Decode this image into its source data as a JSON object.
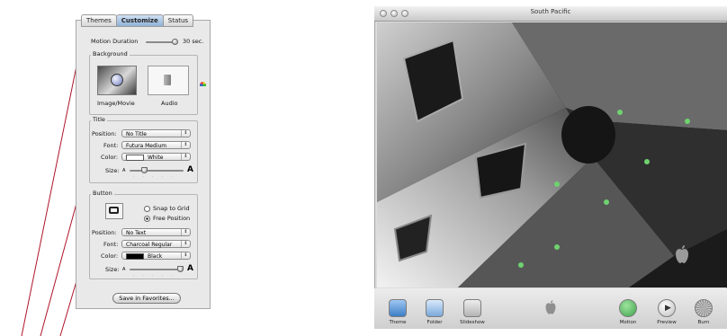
{
  "inspector": {
    "tabs": [
      "Themes",
      "Customize",
      "Status"
    ],
    "selected_tab": "Customize",
    "motion_duration": {
      "label": "Motion Duration",
      "value_text": "30 sec."
    },
    "background": {
      "group_title": "Background",
      "wells": [
        {
          "label": "Image/Movie",
          "icon": "image-movie-icon"
        },
        {
          "label": "Audio",
          "icon": "speaker-icon"
        }
      ]
    },
    "title": {
      "group_title": "Title",
      "position": {
        "label": "Position:",
        "value": "No Title"
      },
      "font": {
        "label": "Font:",
        "value": "Futura Medium"
      },
      "color": {
        "label": "Color:",
        "value": "White",
        "swatch": "#ffffff"
      },
      "size": {
        "label": "Size:",
        "small": "A",
        "large": "A"
      }
    },
    "button": {
      "group_title": "Button",
      "snap_to_grid": "Snap to Grid",
      "free_position": "Free Position",
      "selected_option": "Free Position",
      "position": {
        "label": "Position:",
        "value": "No Text"
      },
      "font": {
        "label": "Font:",
        "value": "Charcoal Regular"
      },
      "color": {
        "label": "Color:",
        "value": "Black",
        "swatch": "#000000"
      },
      "size": {
        "label": "Size:",
        "small": "A",
        "large": "A"
      }
    },
    "save_button": "Save in Favorites..."
  },
  "window": {
    "title": "South Pacific",
    "toolbar_left": [
      {
        "label": "Theme",
        "icon": "theme-icon"
      },
      {
        "label": "Folder",
        "icon": "folder-icon"
      },
      {
        "label": "Slideshow",
        "icon": "slideshow-icon"
      }
    ],
    "toolbar_right": [
      {
        "label": "Motion",
        "icon": "motion-icon"
      },
      {
        "label": "Preview",
        "icon": "play-icon"
      },
      {
        "label": "Burn",
        "icon": "burn-icon"
      }
    ]
  },
  "colors": {
    "motion_green": "#3da34a",
    "selected_tab": "#9dbde0"
  }
}
